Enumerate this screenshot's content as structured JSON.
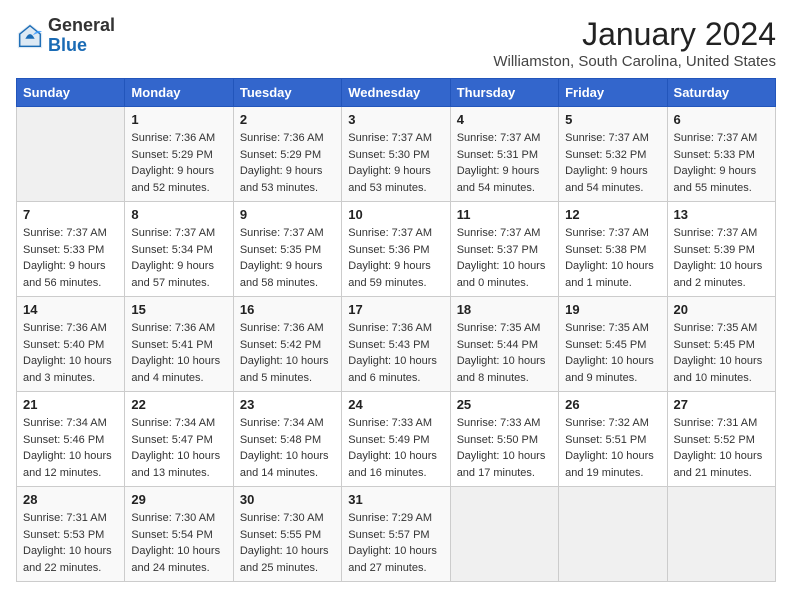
{
  "header": {
    "logo_general": "General",
    "logo_blue": "Blue",
    "month_year": "January 2024",
    "location": "Williamston, South Carolina, United States"
  },
  "days_of_week": [
    "Sunday",
    "Monday",
    "Tuesday",
    "Wednesday",
    "Thursday",
    "Friday",
    "Saturday"
  ],
  "weeks": [
    [
      {
        "num": "",
        "sunrise": "",
        "sunset": "",
        "daylight": ""
      },
      {
        "num": "1",
        "sunrise": "Sunrise: 7:36 AM",
        "sunset": "Sunset: 5:29 PM",
        "daylight": "Daylight: 9 hours and 52 minutes."
      },
      {
        "num": "2",
        "sunrise": "Sunrise: 7:36 AM",
        "sunset": "Sunset: 5:29 PM",
        "daylight": "Daylight: 9 hours and 53 minutes."
      },
      {
        "num": "3",
        "sunrise": "Sunrise: 7:37 AM",
        "sunset": "Sunset: 5:30 PM",
        "daylight": "Daylight: 9 hours and 53 minutes."
      },
      {
        "num": "4",
        "sunrise": "Sunrise: 7:37 AM",
        "sunset": "Sunset: 5:31 PM",
        "daylight": "Daylight: 9 hours and 54 minutes."
      },
      {
        "num": "5",
        "sunrise": "Sunrise: 7:37 AM",
        "sunset": "Sunset: 5:32 PM",
        "daylight": "Daylight: 9 hours and 54 minutes."
      },
      {
        "num": "6",
        "sunrise": "Sunrise: 7:37 AM",
        "sunset": "Sunset: 5:33 PM",
        "daylight": "Daylight: 9 hours and 55 minutes."
      }
    ],
    [
      {
        "num": "7",
        "sunrise": "Sunrise: 7:37 AM",
        "sunset": "Sunset: 5:33 PM",
        "daylight": "Daylight: 9 hours and 56 minutes."
      },
      {
        "num": "8",
        "sunrise": "Sunrise: 7:37 AM",
        "sunset": "Sunset: 5:34 PM",
        "daylight": "Daylight: 9 hours and 57 minutes."
      },
      {
        "num": "9",
        "sunrise": "Sunrise: 7:37 AM",
        "sunset": "Sunset: 5:35 PM",
        "daylight": "Daylight: 9 hours and 58 minutes."
      },
      {
        "num": "10",
        "sunrise": "Sunrise: 7:37 AM",
        "sunset": "Sunset: 5:36 PM",
        "daylight": "Daylight: 9 hours and 59 minutes."
      },
      {
        "num": "11",
        "sunrise": "Sunrise: 7:37 AM",
        "sunset": "Sunset: 5:37 PM",
        "daylight": "Daylight: 10 hours and 0 minutes."
      },
      {
        "num": "12",
        "sunrise": "Sunrise: 7:37 AM",
        "sunset": "Sunset: 5:38 PM",
        "daylight": "Daylight: 10 hours and 1 minute."
      },
      {
        "num": "13",
        "sunrise": "Sunrise: 7:37 AM",
        "sunset": "Sunset: 5:39 PM",
        "daylight": "Daylight: 10 hours and 2 minutes."
      }
    ],
    [
      {
        "num": "14",
        "sunrise": "Sunrise: 7:36 AM",
        "sunset": "Sunset: 5:40 PM",
        "daylight": "Daylight: 10 hours and 3 minutes."
      },
      {
        "num": "15",
        "sunrise": "Sunrise: 7:36 AM",
        "sunset": "Sunset: 5:41 PM",
        "daylight": "Daylight: 10 hours and 4 minutes."
      },
      {
        "num": "16",
        "sunrise": "Sunrise: 7:36 AM",
        "sunset": "Sunset: 5:42 PM",
        "daylight": "Daylight: 10 hours and 5 minutes."
      },
      {
        "num": "17",
        "sunrise": "Sunrise: 7:36 AM",
        "sunset": "Sunset: 5:43 PM",
        "daylight": "Daylight: 10 hours and 6 minutes."
      },
      {
        "num": "18",
        "sunrise": "Sunrise: 7:35 AM",
        "sunset": "Sunset: 5:44 PM",
        "daylight": "Daylight: 10 hours and 8 minutes."
      },
      {
        "num": "19",
        "sunrise": "Sunrise: 7:35 AM",
        "sunset": "Sunset: 5:45 PM",
        "daylight": "Daylight: 10 hours and 9 minutes."
      },
      {
        "num": "20",
        "sunrise": "Sunrise: 7:35 AM",
        "sunset": "Sunset: 5:45 PM",
        "daylight": "Daylight: 10 hours and 10 minutes."
      }
    ],
    [
      {
        "num": "21",
        "sunrise": "Sunrise: 7:34 AM",
        "sunset": "Sunset: 5:46 PM",
        "daylight": "Daylight: 10 hours and 12 minutes."
      },
      {
        "num": "22",
        "sunrise": "Sunrise: 7:34 AM",
        "sunset": "Sunset: 5:47 PM",
        "daylight": "Daylight: 10 hours and 13 minutes."
      },
      {
        "num": "23",
        "sunrise": "Sunrise: 7:34 AM",
        "sunset": "Sunset: 5:48 PM",
        "daylight": "Daylight: 10 hours and 14 minutes."
      },
      {
        "num": "24",
        "sunrise": "Sunrise: 7:33 AM",
        "sunset": "Sunset: 5:49 PM",
        "daylight": "Daylight: 10 hours and 16 minutes."
      },
      {
        "num": "25",
        "sunrise": "Sunrise: 7:33 AM",
        "sunset": "Sunset: 5:50 PM",
        "daylight": "Daylight: 10 hours and 17 minutes."
      },
      {
        "num": "26",
        "sunrise": "Sunrise: 7:32 AM",
        "sunset": "Sunset: 5:51 PM",
        "daylight": "Daylight: 10 hours and 19 minutes."
      },
      {
        "num": "27",
        "sunrise": "Sunrise: 7:31 AM",
        "sunset": "Sunset: 5:52 PM",
        "daylight": "Daylight: 10 hours and 21 minutes."
      }
    ],
    [
      {
        "num": "28",
        "sunrise": "Sunrise: 7:31 AM",
        "sunset": "Sunset: 5:53 PM",
        "daylight": "Daylight: 10 hours and 22 minutes."
      },
      {
        "num": "29",
        "sunrise": "Sunrise: 7:30 AM",
        "sunset": "Sunset: 5:54 PM",
        "daylight": "Daylight: 10 hours and 24 minutes."
      },
      {
        "num": "30",
        "sunrise": "Sunrise: 7:30 AM",
        "sunset": "Sunset: 5:55 PM",
        "daylight": "Daylight: 10 hours and 25 minutes."
      },
      {
        "num": "31",
        "sunrise": "Sunrise: 7:29 AM",
        "sunset": "Sunset: 5:57 PM",
        "daylight": "Daylight: 10 hours and 27 minutes."
      },
      {
        "num": "",
        "sunrise": "",
        "sunset": "",
        "daylight": ""
      },
      {
        "num": "",
        "sunrise": "",
        "sunset": "",
        "daylight": ""
      },
      {
        "num": "",
        "sunrise": "",
        "sunset": "",
        "daylight": ""
      }
    ]
  ]
}
